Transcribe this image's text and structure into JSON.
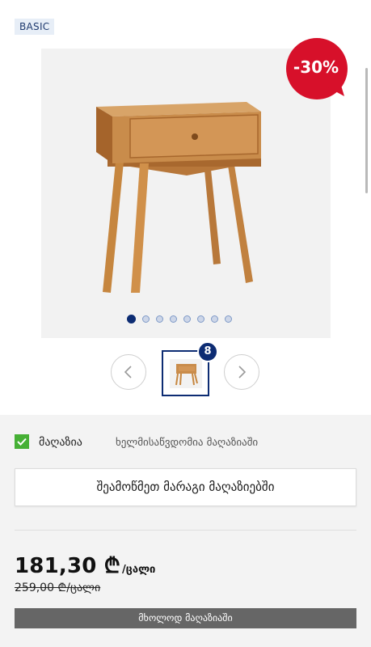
{
  "badge": {
    "label": "BASIC"
  },
  "discount": {
    "label": "-30%"
  },
  "gallery": {
    "image_name": "bedside-table-photo",
    "dots_total": 8,
    "active_dot": 1,
    "thumbnail_count": "8"
  },
  "store": {
    "checkbox_checked": true,
    "label": "მაღაზია",
    "availability": "ხელმისაწვდომია მაღაზიაში"
  },
  "actions": {
    "check_stock_label": "შეამოწმეთ მარაგი მაღაზიებში"
  },
  "price": {
    "current": "181,30 ₾",
    "unit": "/ცალი",
    "old": "259,00 ₾/ცალი"
  },
  "notice": {
    "online_only_label": "მხოლოდ მაღაზიაში"
  },
  "colors": {
    "brand_navy": "#0d2c73",
    "discount_red": "#d7102a",
    "check_green": "#46b035"
  }
}
